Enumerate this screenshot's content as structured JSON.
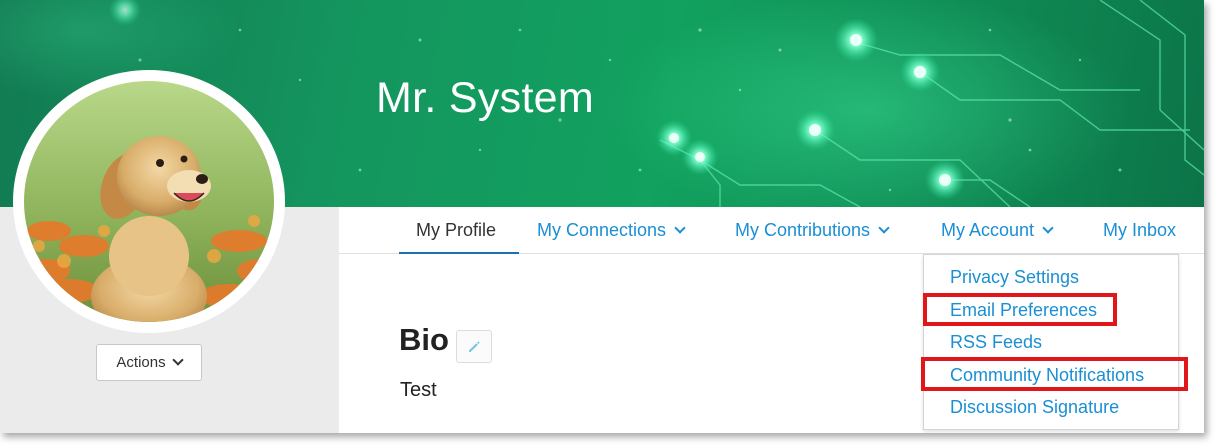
{
  "profile": {
    "name": "Mr. System",
    "actions_label": "Actions"
  },
  "tabs": [
    {
      "label": "My Profile",
      "active": true,
      "has_menu": false
    },
    {
      "label": "My Connections",
      "active": false,
      "has_menu": true
    },
    {
      "label": "My Contributions",
      "active": false,
      "has_menu": true
    },
    {
      "label": "My Account",
      "active": false,
      "has_menu": true
    },
    {
      "label": "My Inbox",
      "active": false,
      "has_menu": false
    }
  ],
  "account_menu": {
    "items": [
      {
        "label": "Privacy Settings",
        "highlighted": false
      },
      {
        "label": "Email Preferences",
        "highlighted": true
      },
      {
        "label": "RSS Feeds",
        "highlighted": false
      },
      {
        "label": "Community Notifications",
        "highlighted": true
      },
      {
        "label": "Discussion Signature",
        "highlighted": false
      }
    ]
  },
  "bio": {
    "heading": "Bio",
    "text": "Test"
  },
  "icons": {
    "edit": "pencil-icon",
    "dropdown": "chevron-down-icon"
  },
  "colors": {
    "link": "#1a8fd4",
    "active_tab_underline": "#1c6fb0",
    "banner": "#14965f",
    "highlight": "#e0161b"
  }
}
